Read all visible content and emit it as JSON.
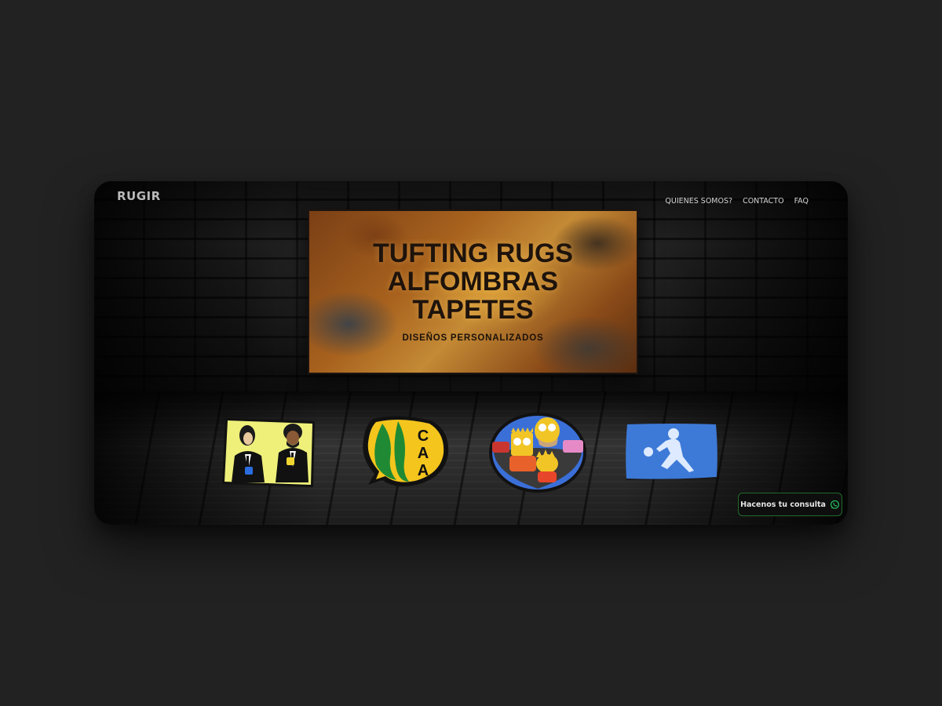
{
  "brand": "RUGIR",
  "nav": {
    "items": [
      "QUIENES SOMOS?",
      "CONTACTO",
      "FAQ"
    ]
  },
  "hero": {
    "lines": [
      "TUFTING RUGS",
      "ALFOMBRAS",
      "TAPETES"
    ],
    "subtitle": "DISEÑOS PERSONALIZADOS"
  },
  "rugs": [
    {
      "name": "pulp-fiction-rug"
    },
    {
      "name": "caa-aldosivi-rug"
    },
    {
      "name": "simpsons-rug"
    },
    {
      "name": "soccer-player-rug"
    }
  ],
  "whatsapp": {
    "label": "Hacenos tu consulta",
    "icon": "whatsapp-icon",
    "color": "#25d366"
  },
  "colors": {
    "background": "#222222",
    "accent_green": "#1f6b2c"
  }
}
